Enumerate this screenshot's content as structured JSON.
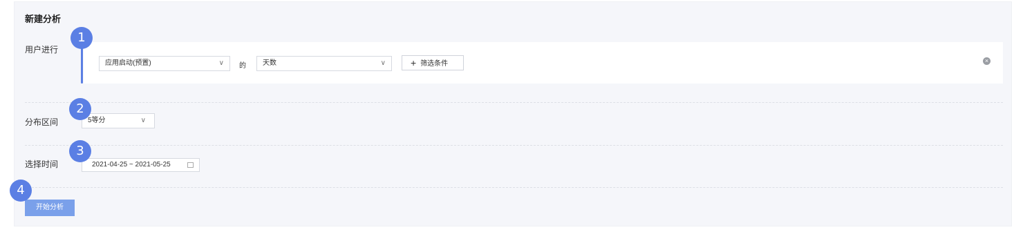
{
  "title": "新建分析",
  "steps": {
    "s1": "1",
    "s2": "2",
    "s3": "3",
    "s4": "4"
  },
  "user_action": {
    "label": "用户进行",
    "event_select": "应用启动(预置)",
    "of_text": "的",
    "metric_select": "天数",
    "filter_button": "筛选条件"
  },
  "distribution": {
    "label": "分布区间",
    "value": "5等分"
  },
  "time": {
    "label": "选择时间",
    "range": "2021-04-25 ~ 2021-05-25"
  },
  "start_button": "开始分析",
  "colors": {
    "accent": "#5b7fe4",
    "button": "#7aa0ea",
    "panel": "#f5f6fa"
  }
}
